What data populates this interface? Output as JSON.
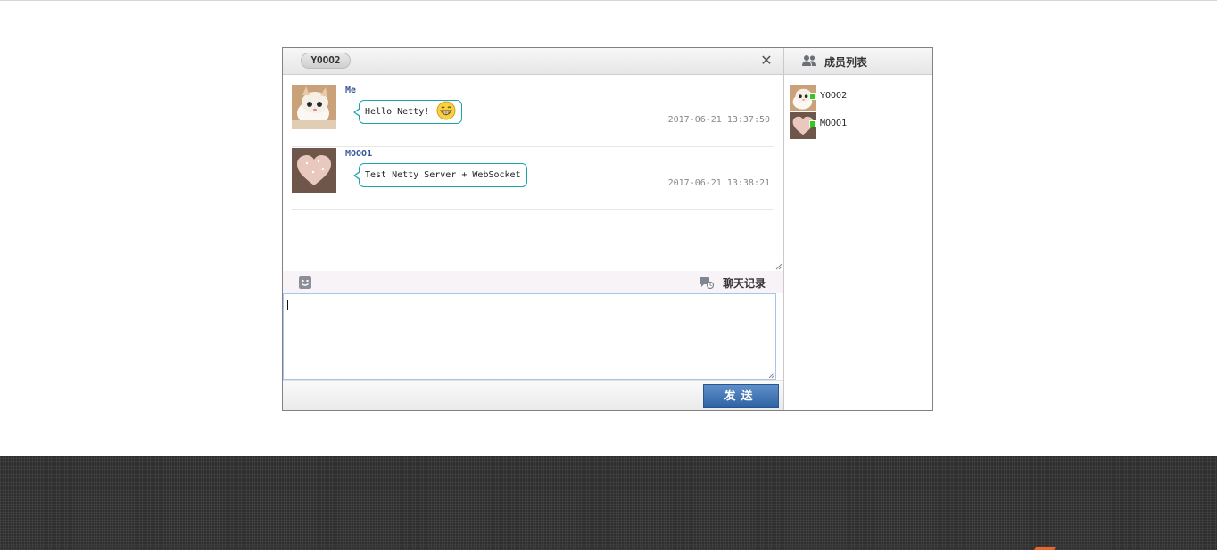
{
  "chat": {
    "tab_label": "YOOO2",
    "close_glyph": "✕",
    "messages": [
      {
        "sender": "Me",
        "text": "Hello Netty!",
        "emoji": "grin-emoji",
        "time": "2017-06-21 13:37:50"
      },
      {
        "sender": "MOOO1",
        "text": "Test Netty Server + WebSocket",
        "time": "2017-06-21 13:38:21"
      }
    ],
    "toolbar": {
      "emoji_icon": "smiley-icon",
      "history_label": "聊天记录"
    },
    "input": {
      "value": ""
    },
    "send_label": "发送"
  },
  "members": {
    "title": "成员列表",
    "items": [
      {
        "name": "YOOO2",
        "status": "online"
      },
      {
        "name": "MOOO1",
        "status": "online"
      }
    ]
  },
  "colors": {
    "accent": "#2e63a3",
    "bubble_border": "#1aa5ad",
    "online": "#2ecc1f",
    "footer_bg": "#2f2f2f"
  }
}
